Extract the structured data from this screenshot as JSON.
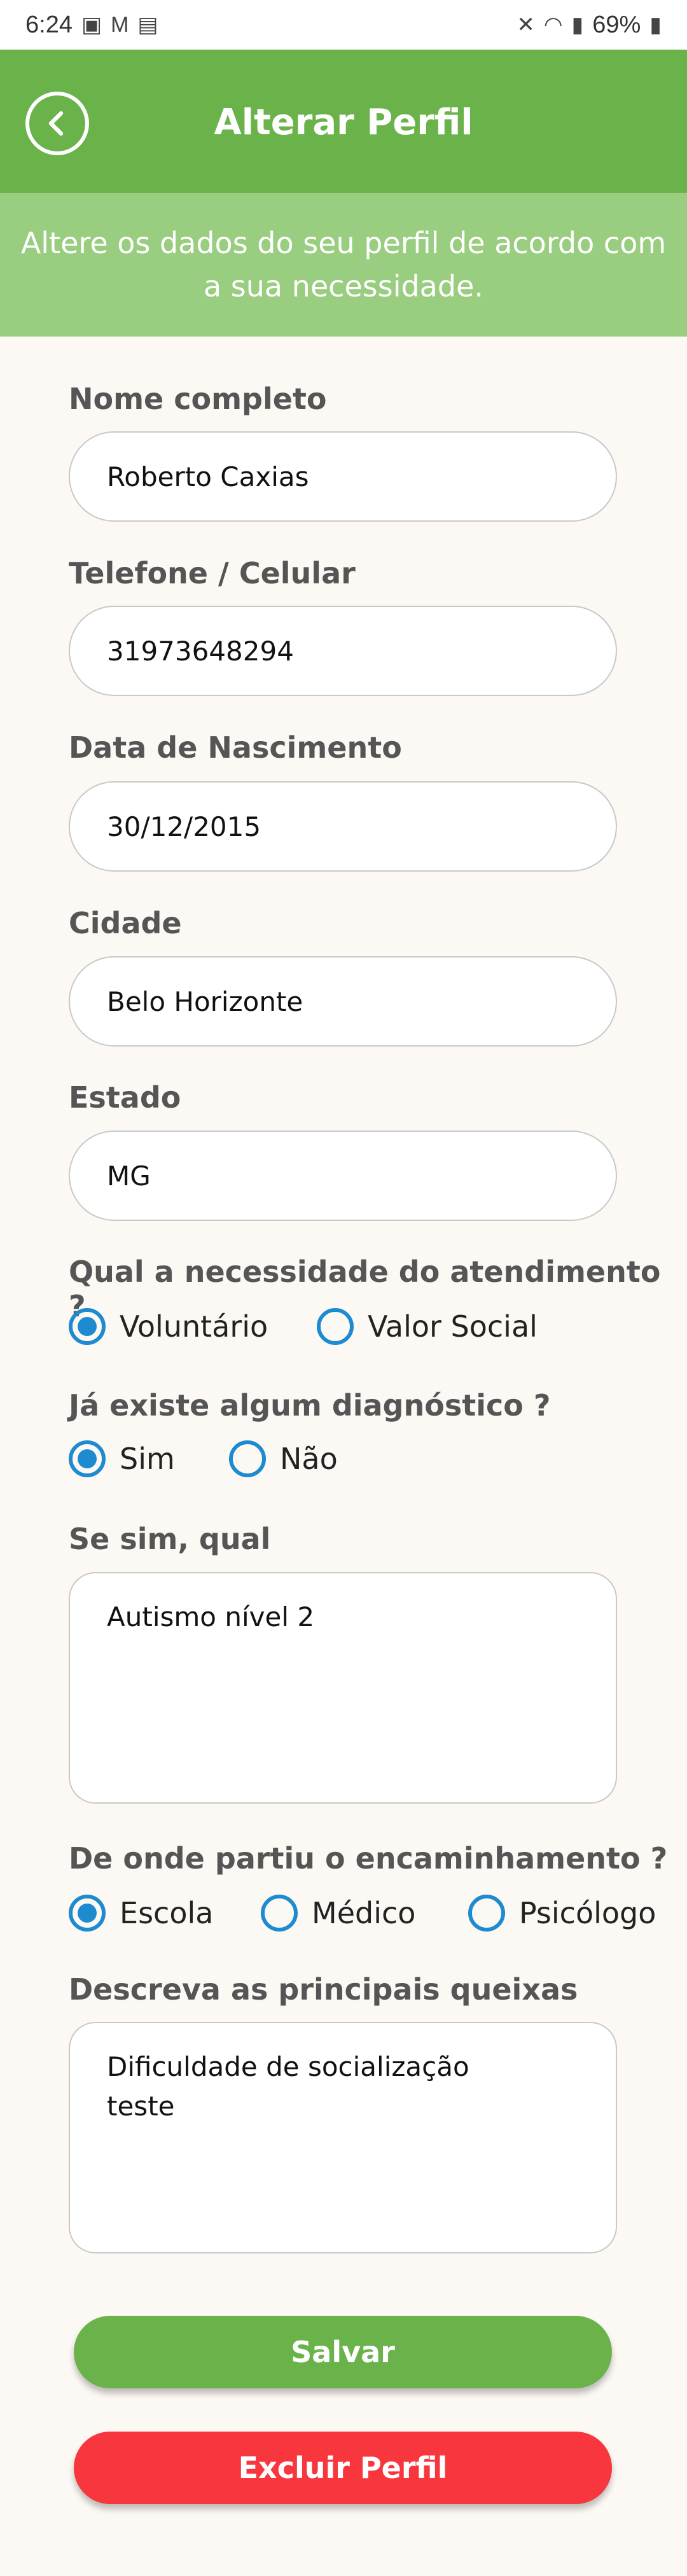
{
  "status_bar": {
    "time": "6:24",
    "battery": "69%"
  },
  "header": {
    "title": "Alterar Perfil"
  },
  "banner": {
    "text": "Altere os dados do seu perfil de acordo com a sua necessidade."
  },
  "form": {
    "name": {
      "label": "Nome completo",
      "value": "Roberto Caxias"
    },
    "phone": {
      "label": "Telefone / Celular",
      "value": "31973648294"
    },
    "birth": {
      "label": "Data de Nascimento",
      "value": "30/12/2015"
    },
    "city": {
      "label": "Cidade",
      "value": "Belo Horizonte"
    },
    "state": {
      "label": "Estado",
      "value": "MG"
    },
    "need": {
      "label": "Qual a necessidade do atendimento ?",
      "options": [
        "Voluntário",
        "Valor Social"
      ],
      "selected": "Voluntário"
    },
    "diagnosis": {
      "label": "Já existe algum diagnóstico ?",
      "options": [
        "Sim",
        "Não"
      ],
      "selected": "Sim"
    },
    "which": {
      "label": "Se sim, qual",
      "value": "Autismo nível 2"
    },
    "referral": {
      "label": "De onde partiu o encaminhamento ?",
      "options": [
        "Escola",
        "Médico",
        "Psicólogo"
      ],
      "selected": "Escola"
    },
    "complaints": {
      "label": "Descreva as principais queixas",
      "value": "Dificuldade de socialização\nteste"
    }
  },
  "buttons": {
    "save": "Salvar",
    "delete": "Excluir Perfil"
  },
  "colors": {
    "header": "#6ab24a",
    "banner": "#99cd7f",
    "radio": "#1e8ad0",
    "delete": "#f7363d"
  }
}
